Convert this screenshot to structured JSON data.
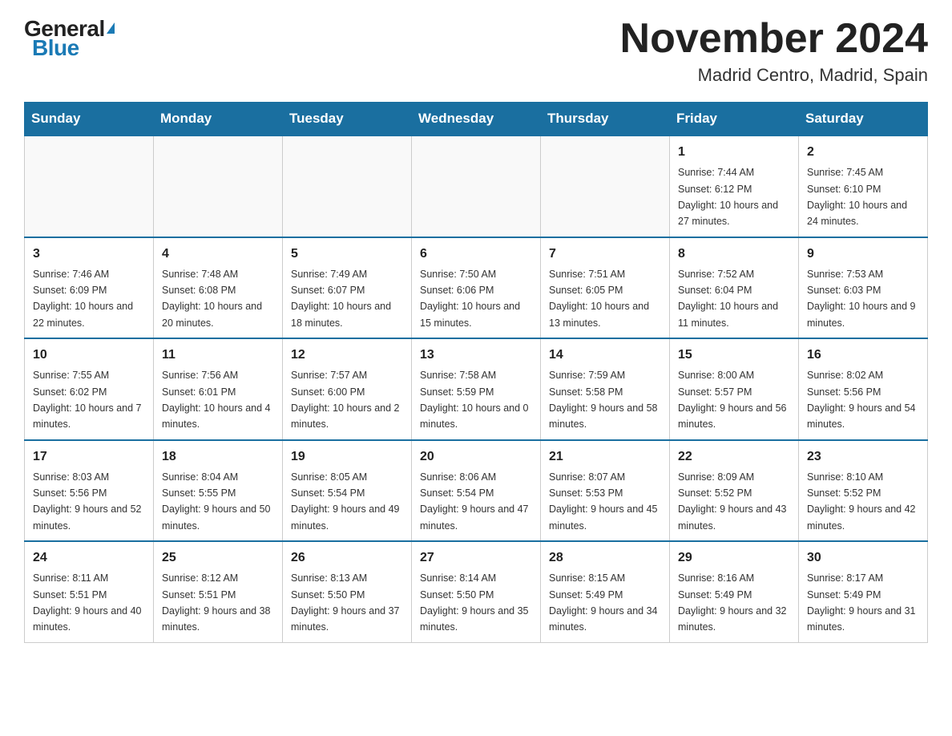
{
  "header": {
    "logo_general": "General",
    "logo_blue": "Blue",
    "month_title": "November 2024",
    "location": "Madrid Centro, Madrid, Spain"
  },
  "days_of_week": [
    "Sunday",
    "Monday",
    "Tuesday",
    "Wednesday",
    "Thursday",
    "Friday",
    "Saturday"
  ],
  "weeks": [
    [
      {
        "day": "",
        "info": ""
      },
      {
        "day": "",
        "info": ""
      },
      {
        "day": "",
        "info": ""
      },
      {
        "day": "",
        "info": ""
      },
      {
        "day": "",
        "info": ""
      },
      {
        "day": "1",
        "info": "Sunrise: 7:44 AM\nSunset: 6:12 PM\nDaylight: 10 hours and 27 minutes."
      },
      {
        "day": "2",
        "info": "Sunrise: 7:45 AM\nSunset: 6:10 PM\nDaylight: 10 hours and 24 minutes."
      }
    ],
    [
      {
        "day": "3",
        "info": "Sunrise: 7:46 AM\nSunset: 6:09 PM\nDaylight: 10 hours and 22 minutes."
      },
      {
        "day": "4",
        "info": "Sunrise: 7:48 AM\nSunset: 6:08 PM\nDaylight: 10 hours and 20 minutes."
      },
      {
        "day": "5",
        "info": "Sunrise: 7:49 AM\nSunset: 6:07 PM\nDaylight: 10 hours and 18 minutes."
      },
      {
        "day": "6",
        "info": "Sunrise: 7:50 AM\nSunset: 6:06 PM\nDaylight: 10 hours and 15 minutes."
      },
      {
        "day": "7",
        "info": "Sunrise: 7:51 AM\nSunset: 6:05 PM\nDaylight: 10 hours and 13 minutes."
      },
      {
        "day": "8",
        "info": "Sunrise: 7:52 AM\nSunset: 6:04 PM\nDaylight: 10 hours and 11 minutes."
      },
      {
        "day": "9",
        "info": "Sunrise: 7:53 AM\nSunset: 6:03 PM\nDaylight: 10 hours and 9 minutes."
      }
    ],
    [
      {
        "day": "10",
        "info": "Sunrise: 7:55 AM\nSunset: 6:02 PM\nDaylight: 10 hours and 7 minutes."
      },
      {
        "day": "11",
        "info": "Sunrise: 7:56 AM\nSunset: 6:01 PM\nDaylight: 10 hours and 4 minutes."
      },
      {
        "day": "12",
        "info": "Sunrise: 7:57 AM\nSunset: 6:00 PM\nDaylight: 10 hours and 2 minutes."
      },
      {
        "day": "13",
        "info": "Sunrise: 7:58 AM\nSunset: 5:59 PM\nDaylight: 10 hours and 0 minutes."
      },
      {
        "day": "14",
        "info": "Sunrise: 7:59 AM\nSunset: 5:58 PM\nDaylight: 9 hours and 58 minutes."
      },
      {
        "day": "15",
        "info": "Sunrise: 8:00 AM\nSunset: 5:57 PM\nDaylight: 9 hours and 56 minutes."
      },
      {
        "day": "16",
        "info": "Sunrise: 8:02 AM\nSunset: 5:56 PM\nDaylight: 9 hours and 54 minutes."
      }
    ],
    [
      {
        "day": "17",
        "info": "Sunrise: 8:03 AM\nSunset: 5:56 PM\nDaylight: 9 hours and 52 minutes."
      },
      {
        "day": "18",
        "info": "Sunrise: 8:04 AM\nSunset: 5:55 PM\nDaylight: 9 hours and 50 minutes."
      },
      {
        "day": "19",
        "info": "Sunrise: 8:05 AM\nSunset: 5:54 PM\nDaylight: 9 hours and 49 minutes."
      },
      {
        "day": "20",
        "info": "Sunrise: 8:06 AM\nSunset: 5:54 PM\nDaylight: 9 hours and 47 minutes."
      },
      {
        "day": "21",
        "info": "Sunrise: 8:07 AM\nSunset: 5:53 PM\nDaylight: 9 hours and 45 minutes."
      },
      {
        "day": "22",
        "info": "Sunrise: 8:09 AM\nSunset: 5:52 PM\nDaylight: 9 hours and 43 minutes."
      },
      {
        "day": "23",
        "info": "Sunrise: 8:10 AM\nSunset: 5:52 PM\nDaylight: 9 hours and 42 minutes."
      }
    ],
    [
      {
        "day": "24",
        "info": "Sunrise: 8:11 AM\nSunset: 5:51 PM\nDaylight: 9 hours and 40 minutes."
      },
      {
        "day": "25",
        "info": "Sunrise: 8:12 AM\nSunset: 5:51 PM\nDaylight: 9 hours and 38 minutes."
      },
      {
        "day": "26",
        "info": "Sunrise: 8:13 AM\nSunset: 5:50 PM\nDaylight: 9 hours and 37 minutes."
      },
      {
        "day": "27",
        "info": "Sunrise: 8:14 AM\nSunset: 5:50 PM\nDaylight: 9 hours and 35 minutes."
      },
      {
        "day": "28",
        "info": "Sunrise: 8:15 AM\nSunset: 5:49 PM\nDaylight: 9 hours and 34 minutes."
      },
      {
        "day": "29",
        "info": "Sunrise: 8:16 AM\nSunset: 5:49 PM\nDaylight: 9 hours and 32 minutes."
      },
      {
        "day": "30",
        "info": "Sunrise: 8:17 AM\nSunset: 5:49 PM\nDaylight: 9 hours and 31 minutes."
      }
    ]
  ]
}
